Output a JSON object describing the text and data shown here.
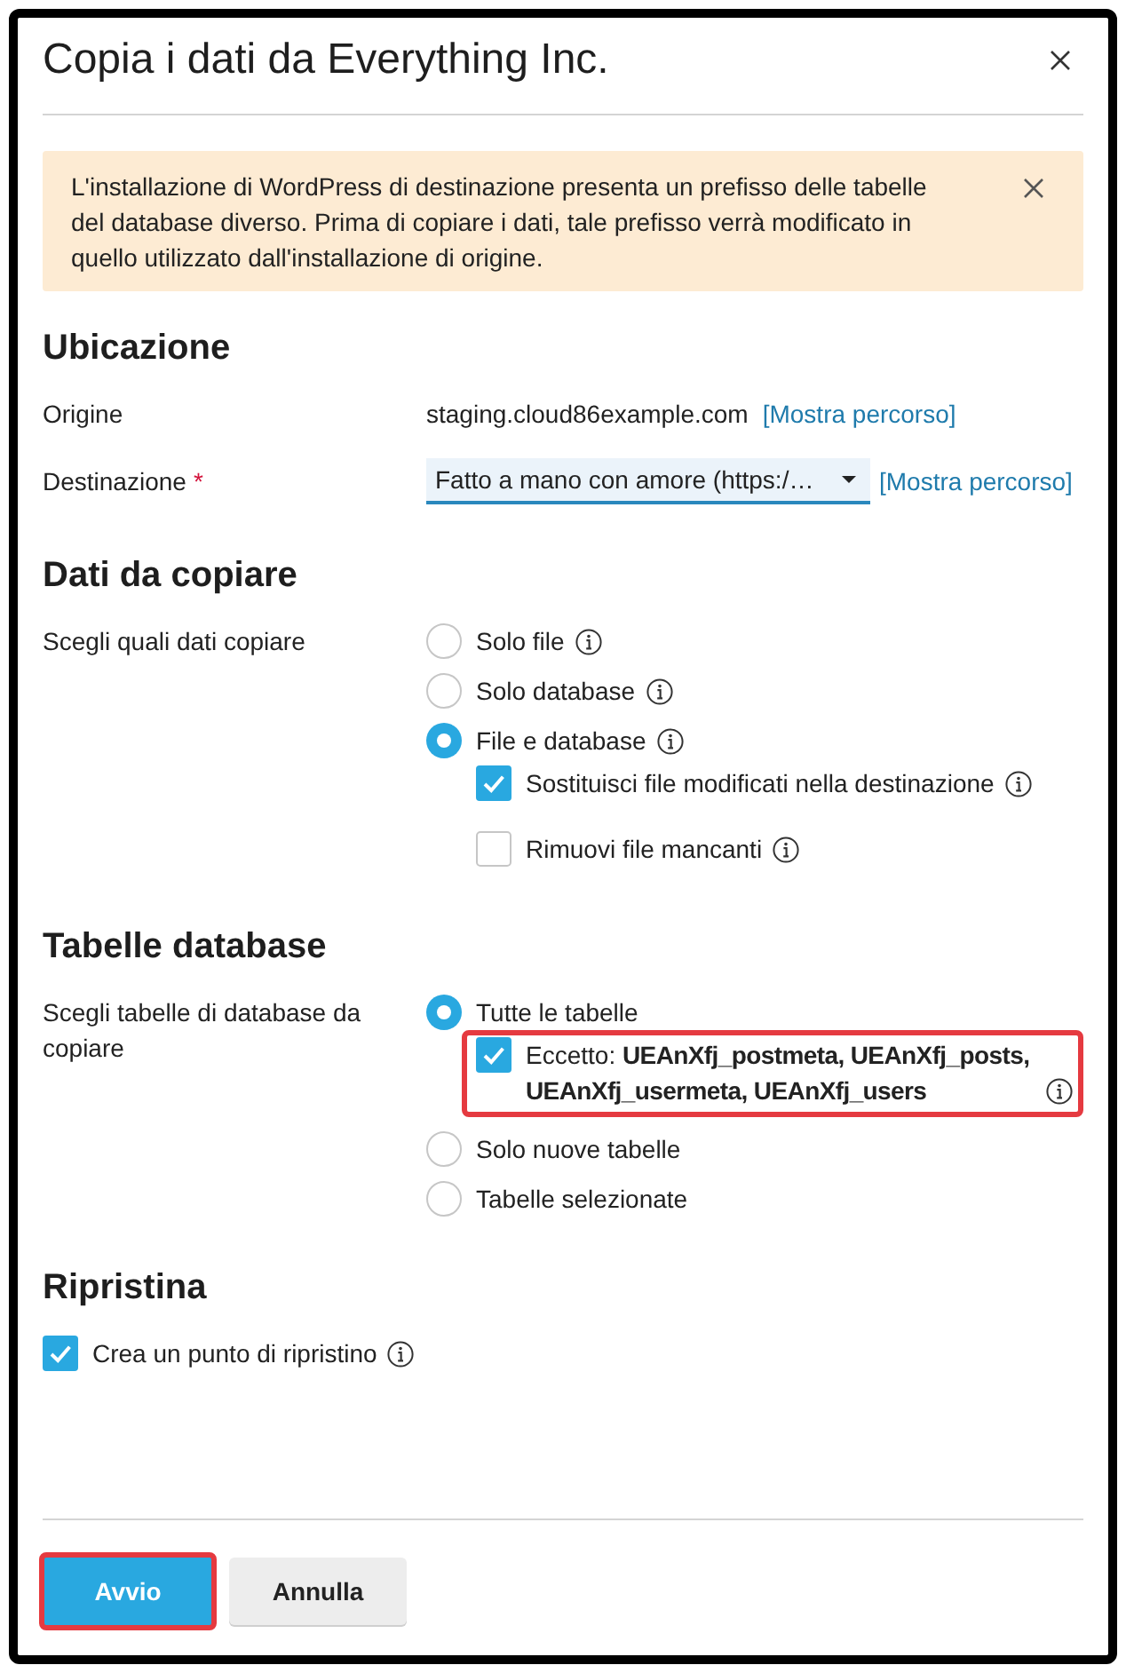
{
  "dialog": {
    "title": "Copia i dati da Everything Inc."
  },
  "alert": {
    "text": "L'installazione di WordPress di destinazione presenta un prefisso delle tabelle del database diverso. Prima di copiare i dati, tale prefisso verrà modificato in quello utilizzato dall'installazione di origine."
  },
  "sections": [
    {
      "heading": "Ubicazione",
      "fields": [
        {
          "kind": "text",
          "label": "Origine",
          "value": "staging.cloud86example.com",
          "link": "[Mostra percorso]"
        },
        {
          "kind": "select",
          "label": "Destinazione",
          "required_mark": "*",
          "value": "Fatto a mano con amore (https:/…",
          "link": "[Mostra percorso]"
        }
      ]
    },
    {
      "heading": "Dati da copiare",
      "fields": [
        {
          "kind": "radios",
          "label": "Scegli quali dati copiare",
          "options": [
            {
              "label": "Solo file",
              "selected": false,
              "info": true
            },
            {
              "label": "Solo database",
              "selected": false,
              "info": true
            },
            {
              "label": "File e database",
              "selected": true,
              "info": true,
              "suboptions": [
                {
                  "label": "Sostituisci file modificati nella destinazione",
                  "checked": true,
                  "info": true,
                  "highlighted": false
                },
                {
                  "label": "Rimuovi file mancanti",
                  "checked": false,
                  "info": true,
                  "highlighted": false
                }
              ]
            }
          ]
        }
      ]
    },
    {
      "heading": "Tabelle database",
      "fields": [
        {
          "kind": "radios",
          "label": "Scegli tabelle di database da copiare",
          "options": [
            {
              "label": "Tutte le tabelle",
              "selected": true,
              "info": false,
              "suboptions": [
                {
                  "label": "Eccetto: **UEAnXfj_postmeta, UEAnXfj_posts, UEAnXfj_usermeta, UEAnXfj_users**",
                  "checked": true,
                  "info": true,
                  "highlighted": true
                }
              ]
            },
            {
              "label": "Solo nuove tabelle",
              "selected": false,
              "info": false
            },
            {
              "label": "Tabelle selezionate",
              "selected": false,
              "info": false
            }
          ]
        }
      ]
    },
    {
      "heading": "Ripristina",
      "fields": [
        {
          "kind": "checkbox",
          "label": "Crea un punto di ripristino",
          "checked": true,
          "info": true
        }
      ]
    }
  ],
  "buttons": [
    {
      "kind": "primary",
      "label": "Avvio",
      "highlighted": true
    },
    {
      "kind": "secondary",
      "label": "Annulla",
      "highlighted": false
    }
  ]
}
